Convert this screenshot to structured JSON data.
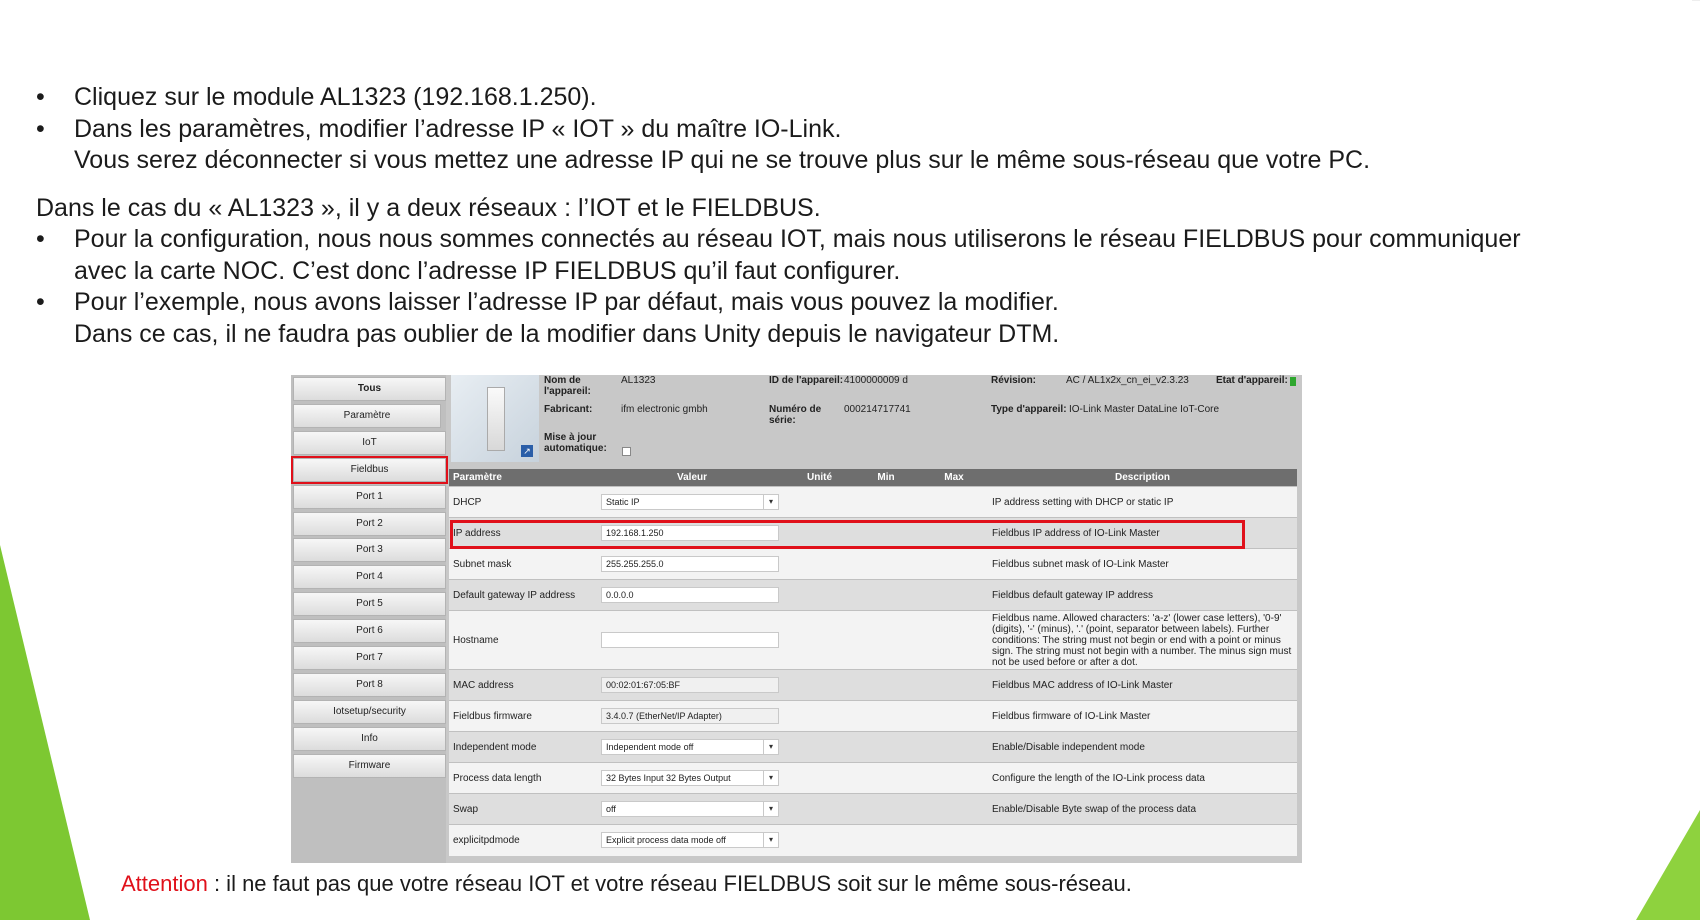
{
  "slide": {
    "lines": [
      {
        "type": "bullet",
        "text": "Cliquez sur le module AL1323 (192.168.1.250)."
      },
      {
        "type": "bullet",
        "text": "Dans les paramètres, modifier l’adresse IP « IOT » du maître IO-Link."
      },
      {
        "type": "cont",
        "text": "Vous serez déconnecter si vous mettez une adresse IP qui ne se trouve plus sur le même sous-réseau que votre PC."
      },
      {
        "type": "para",
        "text": "Dans le cas du « AL1323 », il y a deux réseaux : l’IOT et le FIELDBUS."
      },
      {
        "type": "bullet",
        "text": "Pour la configuration, nous nous sommes connectés au réseau IOT, mais nous utiliserons le réseau FIELDBUS pour communiquer"
      },
      {
        "type": "cont",
        "text": "avec la carte NOC. C’est donc l’adresse IP FIELDBUS qu’il faut configurer."
      },
      {
        "type": "bullet",
        "text": "Pour l’exemple, nous avons laisser l’adresse IP par défaut, mais vous pouvez la modifier."
      },
      {
        "type": "cont",
        "text": "Dans ce cas, il ne faudra pas oublier de la modifier dans Unity depuis le navigateur DTM."
      }
    ],
    "attention_label": "Attention",
    "attention_text": " : il ne faut pas que votre réseau IOT et votre réseau FIELDBUS soit sur le même sous-réseau.",
    "accent_color": "#e0101a",
    "deco_color": "#7dc832"
  },
  "screenshot": {
    "sidebar": [
      "Tous",
      "Paramètre",
      "IoT",
      "Fieldbus",
      "Port 1",
      "Port 2",
      "Port 3",
      "Port 4",
      "Port 5",
      "Port 6",
      "Port 7",
      "Port 8",
      "Iotsetup/security",
      "Info",
      "Firmware"
    ],
    "highlighted_tab": "Fieldbus",
    "device": {
      "name_label": "Nom de l'appareil:",
      "name_value": "AL1323",
      "manufacturer_label": "Fabricant:",
      "manufacturer_value": "ifm electronic gmbh",
      "autoupdate_label": "Mise à jour automatique:",
      "id_label": "ID de l'appareil:",
      "id_value": "4100000009 d",
      "serial_label": "Numéro de série:",
      "serial_value": "000214717741",
      "revision_label": "Révision:",
      "revision_value": "AC / AL1x2x_cn_ei_v2.3.23",
      "type_label": "Type d'appareil:",
      "type_value": "IO-Link Master DataLine IoT-Core",
      "state_label": "Etat d'appareil:",
      "state_color": "#2ea62e"
    },
    "columns": [
      "Paramètre",
      "Valeur",
      "Unité",
      "Min",
      "Max",
      "Description"
    ],
    "rows": [
      {
        "param": "DHCP",
        "value": "Static IP",
        "kind": "select",
        "desc": "IP address setting with DHCP or static IP"
      },
      {
        "param": "IP address",
        "value": "192.168.1.250",
        "kind": "input",
        "desc": "Fieldbus IP address of IO-Link Master",
        "highlight": true
      },
      {
        "param": "Subnet mask",
        "value": "255.255.255.0",
        "kind": "input",
        "desc": "Fieldbus subnet mask of IO-Link Master"
      },
      {
        "param": "Default gateway IP address",
        "value": "0.0.0.0",
        "kind": "input",
        "desc": "Fieldbus default gateway IP address"
      },
      {
        "param": "Hostname",
        "value": "",
        "kind": "input",
        "desc": "Fieldbus name. Allowed characters: 'a-z' (lower case letters), '0-9' (digits), '-' (minus), '.' (point, separator between labels). Further conditions: The string must not begin or end with a point or minus sign. The string must not begin with a number. The minus sign must not be used before or after a dot."
      },
      {
        "param": "MAC address",
        "value": "00:02:01:67:05:BF",
        "kind": "readonly",
        "desc": "Fieldbus MAC address of IO-Link Master"
      },
      {
        "param": "Fieldbus firmware",
        "value": "3.4.0.7 (EtherNet/IP Adapter)",
        "kind": "readonly",
        "desc": "Fieldbus firmware of IO-Link Master"
      },
      {
        "param": "Independent mode",
        "value": "Independent mode off",
        "kind": "select",
        "desc": "Enable/Disable independent mode"
      },
      {
        "param": "Process data length",
        "value": "32 Bytes Input 32 Bytes Output",
        "kind": "select",
        "desc": "Configure the length of the IO-Link process data"
      },
      {
        "param": "Swap",
        "value": "off",
        "kind": "select",
        "desc": "Enable/Disable Byte swap of the process data"
      },
      {
        "param": "explicitpdmode",
        "value": "Explicit process data mode off",
        "kind": "select",
        "desc": ""
      }
    ]
  }
}
